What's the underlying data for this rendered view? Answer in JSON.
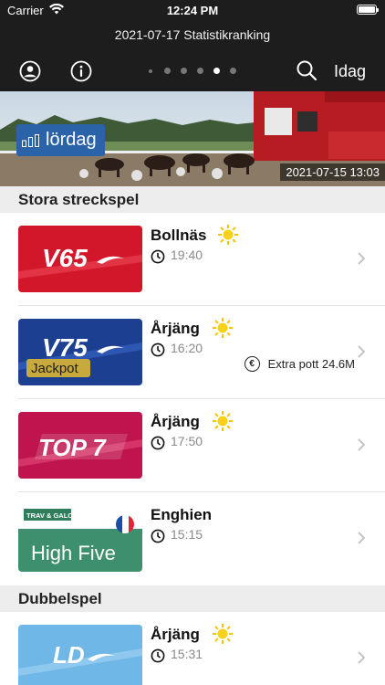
{
  "status_bar": {
    "carrier": "Carrier",
    "time": "12:24 PM"
  },
  "nav": {
    "title": "2021-07-17 Statistikranking",
    "profile_icon": "person-circle-icon",
    "info_icon": "info-circle-icon",
    "search_icon": "search-icon",
    "today_label": "Idag",
    "page_dots": {
      "count": 6,
      "active_index": 4
    }
  },
  "hero": {
    "day_label": "lördag",
    "timestamp": "2021-07-15 13:03"
  },
  "sections": [
    {
      "title": "Stora streckspel",
      "rows": [
        {
          "game": "V65",
          "track": "Bollnäs",
          "time": "19:40",
          "weather": "sun-icon"
        },
        {
          "game": "V75",
          "badge": "Jackpot",
          "track": "Årjäng",
          "time": "16:20",
          "weather": "sun-icon",
          "extra": "Extra pott 24.6M"
        },
        {
          "game": "TOP 7",
          "track": "Årjäng",
          "time": "17:50",
          "weather": "sun-icon"
        },
        {
          "game": "High Five",
          "brand": "TRAV & GALOPP",
          "track": "Enghien",
          "time": "15:15",
          "flag": "france-flag-icon"
        }
      ]
    },
    {
      "title": "Dubbelspel",
      "rows": [
        {
          "game": "LD",
          "track": "Årjäng",
          "time": "15:31",
          "weather": "sun-icon"
        }
      ]
    }
  ],
  "colors": {
    "v65": "#d3172a",
    "v75": "#1d3f91",
    "top7": "#c0144e",
    "highfive": "#3d8f6d",
    "ld": "#6fb7e6",
    "header_bg": "#1d1d1d",
    "jackpot": "#c8a93d"
  }
}
